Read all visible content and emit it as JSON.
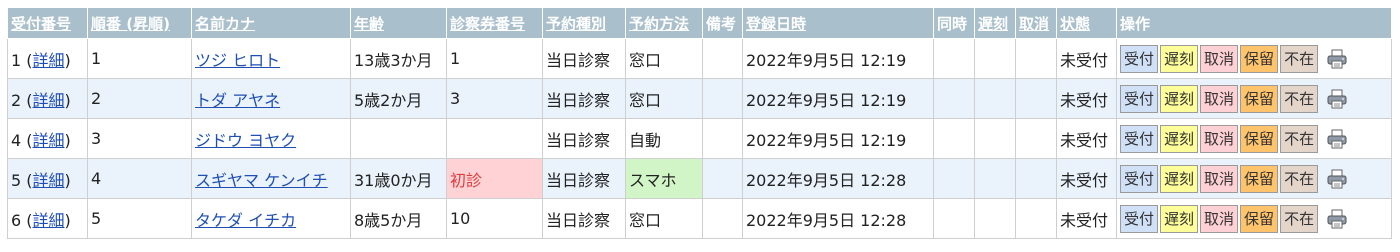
{
  "columns": {
    "reception_no": "受付番号",
    "order": "順番 (昇順)",
    "name_kana": "名前カナ",
    "age": "年齢",
    "ticket_no": "診察券番号",
    "reservation_type": "予約種別",
    "reservation_method": "予約方法",
    "remarks": "備考",
    "registered_at": "登録日時",
    "concurrent": "同時",
    "late": "遅刻",
    "cancel": "取消",
    "status": "状態",
    "actions": "操作"
  },
  "labels": {
    "detail": "詳細",
    "paren_open": " (",
    "paren_close": ")"
  },
  "buttons": {
    "accept": "受付",
    "late": "遅刻",
    "cancel": "取消",
    "hold": "保留",
    "absent": "不在"
  },
  "rows": [
    {
      "reception_no": "1",
      "order": "1",
      "name": "ツジ ヒロト",
      "age": "13歳3か月",
      "ticket": "1",
      "type": "当日診察",
      "method": "窓口",
      "remarks": "",
      "registered": "2022年9月5日 12:19",
      "concurrent": "",
      "late": "",
      "cancel": "",
      "status": "未受付"
    },
    {
      "reception_no": "2",
      "order": "2",
      "name": "トダ アヤネ",
      "age": "5歳2か月",
      "ticket": "3",
      "type": "当日診察",
      "method": "窓口",
      "remarks": "",
      "registered": "2022年9月5日 12:19",
      "concurrent": "",
      "late": "",
      "cancel": "",
      "status": "未受付"
    },
    {
      "reception_no": "4",
      "order": "3",
      "name": "ジドウ ヨヤク",
      "age": "",
      "ticket": "",
      "type": "当日診察",
      "method": "自動",
      "remarks": "",
      "registered": "2022年9月5日 12:19",
      "concurrent": "",
      "late": "",
      "cancel": "",
      "status": "未受付"
    },
    {
      "reception_no": "5",
      "order": "4",
      "name": "スギヤマ ケンイチ",
      "age": "31歳0か月",
      "ticket": "初診",
      "type": "当日診察",
      "method": "スマホ",
      "remarks": "",
      "registered": "2022年9月5日 12:28",
      "concurrent": "",
      "late": "",
      "cancel": "",
      "status": "未受付"
    },
    {
      "reception_no": "6",
      "order": "5",
      "name": "タケダ イチカ",
      "age": "8歳5か月",
      "ticket": "10",
      "type": "当日診察",
      "method": "窓口",
      "remarks": "",
      "registered": "2022年9月5日 12:28",
      "concurrent": "",
      "late": "",
      "cancel": "",
      "status": "未受付"
    }
  ],
  "icons": {
    "print": "printer-icon"
  },
  "colors": {
    "header_bg": "#a9bfcc",
    "link": "#1f4fb4",
    "row_alt": "#eaf2fb",
    "first_visit_bg": "#ffd3d6",
    "first_visit_text": "#e03b3b",
    "smartphone_bg": "#d2f5c8",
    "btn_accept": "#cfe0f7",
    "btn_late": "#ffff99",
    "btn_cancel": "#ffd0d4",
    "btn_hold": "#ffc36b",
    "btn_absent": "#e3d5c9"
  }
}
